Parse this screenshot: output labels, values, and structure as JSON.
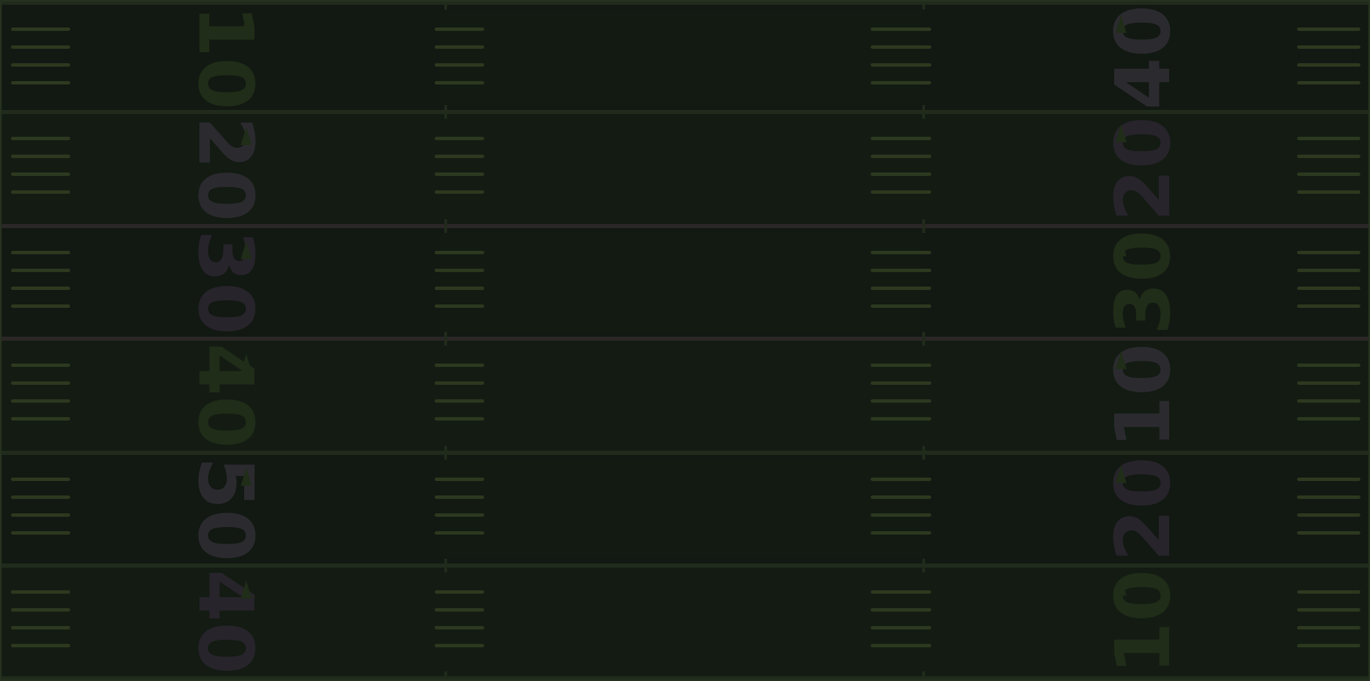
{
  "field": {
    "grass_color": "#182018",
    "grass_stripe_color": "#1a241a",
    "line_color": "#2d3a26",
    "hash_color": "#3d4d2a",
    "number_colors": [
      "#2b3d20",
      "#3a3a3f",
      "#35303a"
    ]
  },
  "yard_numbers": {
    "left": [
      "10",
      "20",
      "30",
      "40",
      "50",
      "40"
    ],
    "right": [
      "40",
      "20",
      "30",
      "10",
      "20",
      "10"
    ]
  }
}
